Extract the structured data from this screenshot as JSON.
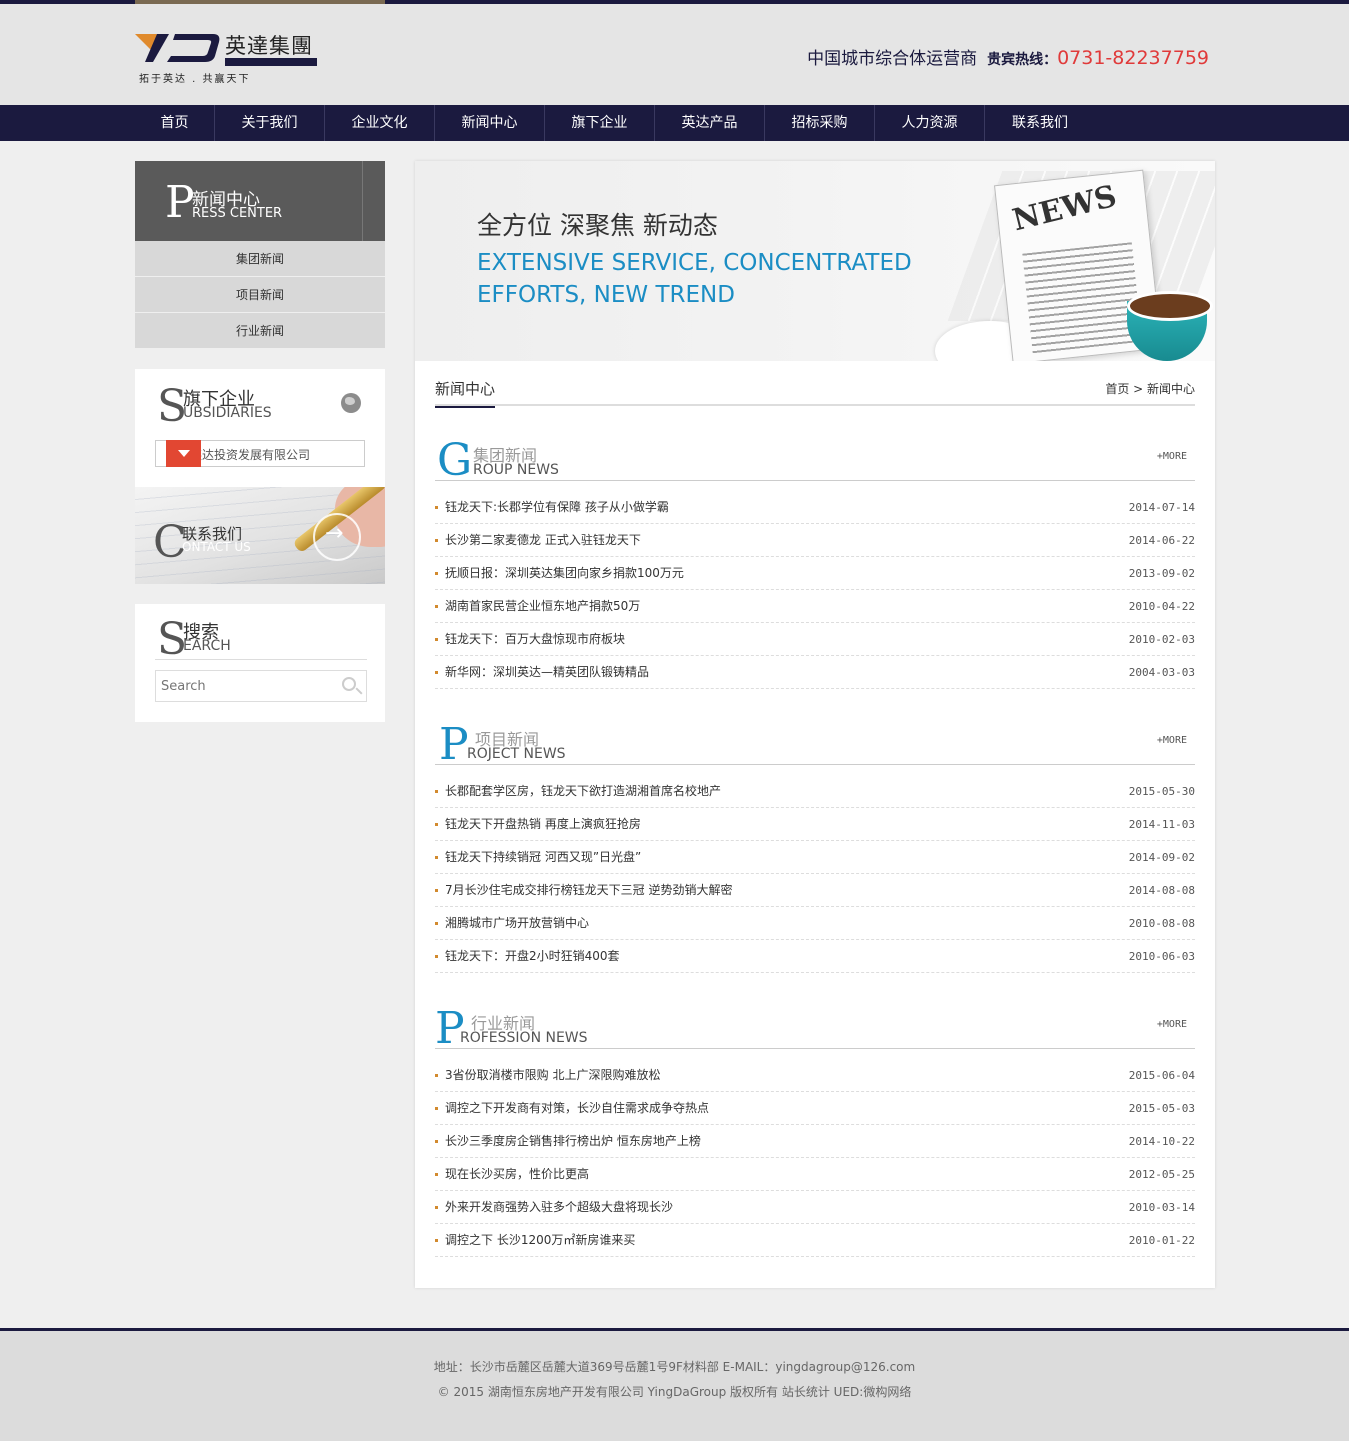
{
  "header": {
    "logo_cn": "英達集團",
    "logo_slogan": "拓于英达 . 共赢天下",
    "tagline": "中国城市综合体运营商",
    "hotline_label": "贵宾热线：",
    "hotline_number": "0731-82237759"
  },
  "nav": {
    "items": [
      {
        "label": "首页"
      },
      {
        "label": "关于我们"
      },
      {
        "label": "企业文化"
      },
      {
        "label": "新闻中心"
      },
      {
        "label": "旗下企业"
      },
      {
        "label": "英达产品"
      },
      {
        "label": "招标采购"
      },
      {
        "label": "人力资源"
      },
      {
        "label": "联系我们"
      }
    ]
  },
  "sidebar": {
    "press": {
      "letter": "P",
      "cn": "新闻中心",
      "en": "RESS CENTER"
    },
    "menu": [
      {
        "label": "集团新闻"
      },
      {
        "label": "项目新闻"
      },
      {
        "label": "行业新闻"
      }
    ],
    "subsidiaries": {
      "letter": "S",
      "cn": "旗下企业",
      "en": "UBSIDIARIES",
      "selected": "深圳英达投资发展有限公司"
    },
    "contact": {
      "letter": "C",
      "cn": "联系我们",
      "en": "ONTACT US"
    },
    "search": {
      "letter": "S",
      "cn": "搜索",
      "en": "EARCH",
      "placeholder": "Search"
    }
  },
  "banner": {
    "title_cn": "全方位 深聚焦 新动态",
    "title_en": "EXTENSIVE SERVICE, CONCENTRATED EFFORTS, NEW TREND",
    "paper_text": "NEWS"
  },
  "main": {
    "title": "新闻中心",
    "breadcrumb": "首页 > 新闻中心",
    "sections": [
      {
        "letter": "G",
        "cn": "集团新闻",
        "en": "ROUP NEWS",
        "more": "+MORE",
        "items": [
          {
            "title": "钰龙天下:长郡学位有保障 孩子从小做学霸",
            "date": "2014-07-14"
          },
          {
            "title": "长沙第二家麦德龙 正式入驻钰龙天下",
            "date": "2014-06-22"
          },
          {
            "title": "抚顺日报：深圳英达集团向家乡捐款100万元",
            "date": "2013-09-02"
          },
          {
            "title": "湖南首家民营企业恒东地产捐款50万",
            "date": "2010-04-22"
          },
          {
            "title": "钰龙天下：百万大盘惊现市府板块",
            "date": "2010-02-03"
          },
          {
            "title": "新华网：深圳英达—精英团队锻铸精品",
            "date": "2004-03-03"
          }
        ]
      },
      {
        "letter": "P",
        "cn": "项目新闻",
        "en": "ROJECT NEWS",
        "more": "+MORE",
        "items": [
          {
            "title": "长郡配套学区房，钰龙天下欲打造湖湘首席名校地产",
            "date": "2015-05-30"
          },
          {
            "title": "钰龙天下开盘热销 再度上演疯狂抢房",
            "date": "2014-11-03"
          },
          {
            "title": "钰龙天下持续销冠 河西又现”日光盘”",
            "date": "2014-09-02"
          },
          {
            "title": "7月长沙住宅成交排行榜钰龙天下三冠 逆势劲销大解密",
            "date": "2014-08-08"
          },
          {
            "title": "湘腾城市广场开放营销中心",
            "date": "2010-08-08"
          },
          {
            "title": "钰龙天下：开盘2小时狂销400套",
            "date": "2010-06-03"
          }
        ]
      },
      {
        "letter": "P",
        "cn": "行业新闻",
        "en": "ROFESSION NEWS",
        "more": "+MORE",
        "items": [
          {
            "title": "3省份取消楼市限购 北上广深限购难放松",
            "date": "2015-06-04"
          },
          {
            "title": "调控之下开发商有对策，长沙自住需求成争夺热点",
            "date": "2015-05-03"
          },
          {
            "title": "长沙三季度房企销售排行榜出炉 恒东房地产上榜",
            "date": "2014-10-22"
          },
          {
            "title": "现在长沙买房，性价比更高",
            "date": "2012-05-25"
          },
          {
            "title": "外来开发商强势入驻多个超级大盘将现长沙",
            "date": "2010-03-14"
          },
          {
            "title": "调控之下 长沙1200万㎡新房谁来买",
            "date": "2010-01-22"
          }
        ]
      }
    ]
  },
  "footer": {
    "line1": "地址：长沙市岳麓区岳麓大道369号岳麓1号9F材料部     E-MAIL：yingdagroup@126.com",
    "line2": "© 2015 湖南恒东房地产开发有限公司 YingDaGroup 版权所有 站长统计 UED:微构网络"
  },
  "colors": {
    "navy": "#1b1a3f",
    "accent_blue": "#1b8dc4",
    "hotline_red": "#e03a3a",
    "select_red": "#e24732"
  }
}
